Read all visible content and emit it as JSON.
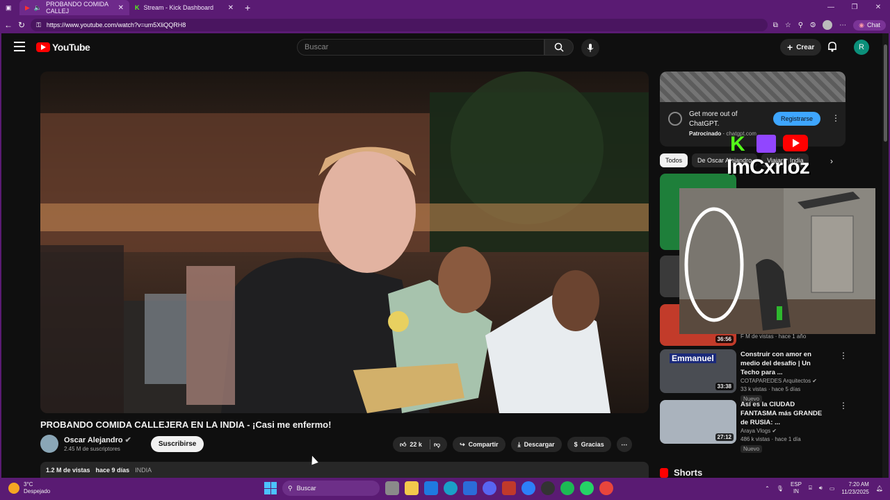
{
  "browser": {
    "tabs": [
      {
        "label": "PROBANDO COMIDA CALLEJ",
        "active": true
      },
      {
        "label": "Stream - Kick Dashboard",
        "active": false
      }
    ],
    "url": "https://www.youtube.com/watch?v=um5XliQQRH8",
    "chat_label": "Chat"
  },
  "youtube": {
    "logo_text": "YouTube",
    "search_placeholder": "Buscar",
    "create_label": "Crear",
    "avatar_letter": "R"
  },
  "video": {
    "title": "PROBANDO COMIDA CALLEJERA EN LA INDIA - ¡Casi me enfermo!",
    "channel": "Oscar Alejandro",
    "subscribers": "2.45 M de suscriptores",
    "subscribe_label": "Suscribirse",
    "likes": "22 k",
    "share_label": "Compartir",
    "download_label": "Descargar",
    "thanks_label": "Gracias",
    "views": "1.2 M de vistas",
    "date": "hace 9 días",
    "tag": "INDIA"
  },
  "ad": {
    "text": "Get more out of ChatGPT.",
    "sponsored": "Patrocinado",
    "domain": "chatgpt.com",
    "cta": "Registrarse"
  },
  "chips": [
    "Todos",
    "De Oscar Alejandro",
    "Viajar a India"
  ],
  "overlay": {
    "name": "ImCxrloz"
  },
  "recommendations": [
    {
      "title": "Construir con amor en medio del desafío | Un Techo para ...",
      "channel": "COTAPAREDES Arquitectos",
      "meta": "33 k vistas · hace 5 días",
      "badge": "Nuevo",
      "duration": "33:38",
      "thumb_text": "Emmanuel"
    },
    {
      "title": "Así es la CIUDAD FANTASMA más GRANDE de RUSIA: ...",
      "channel": "Araya Vlogs",
      "meta": "486 k vistas · hace 1 día",
      "badge": "Nuevo",
      "duration": "27:12"
    }
  ],
  "partial_thumb": {
    "duration": "36:56",
    "meta": "F M de vistas · hace 1 año"
  },
  "shorts_label": "Shorts",
  "taskbar": {
    "temp": "3°C",
    "weather": "Despejado",
    "search": "Buscar",
    "lang": "ESP",
    "region": "IN",
    "time": "7:20 AM",
    "date": "11/23/2025"
  }
}
